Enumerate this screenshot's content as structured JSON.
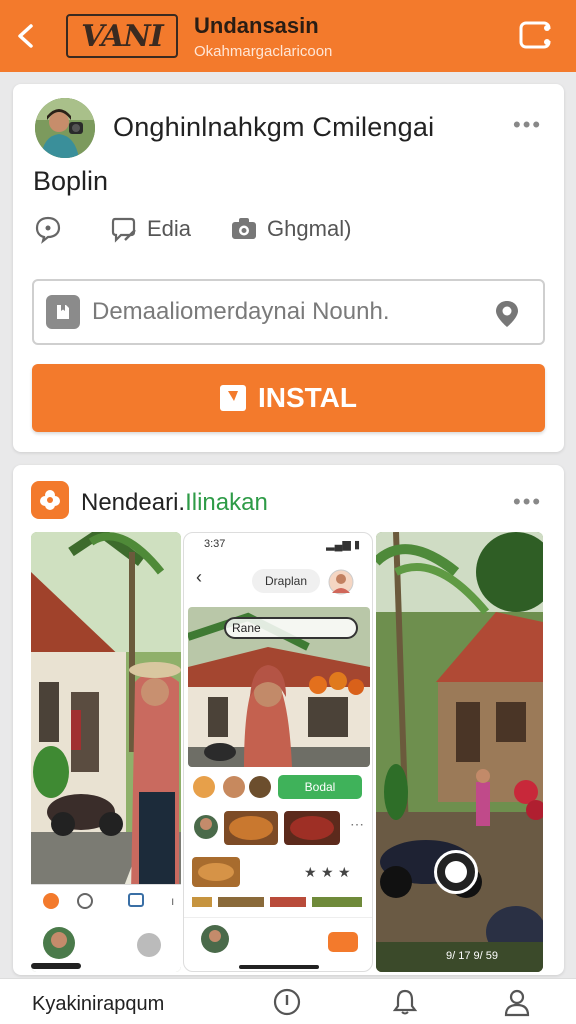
{
  "header": {
    "logo_text": "VANI",
    "title": "Undansasin",
    "subtitle": "Okahmargaclaricoon",
    "back_icon": "arrow-left-icon",
    "menu_icon": "share-menu-icon"
  },
  "post": {
    "title": "Onghinlnahkgm Cmilengai",
    "subtitle": "Boplin",
    "actions": [
      {
        "icon": "chat-bubble-icon",
        "label": ""
      },
      {
        "icon": "chat-edit-icon",
        "label": "Edia"
      },
      {
        "icon": "camera-icon",
        "label": "Ghgmal)"
      }
    ],
    "search_placeholder": "Demaaliomerdaynai Nounh.",
    "install_label": "INSTAL"
  },
  "app_card": {
    "title_main": "Nendeari.",
    "title_accent": "Ilinakan",
    "screenshot_mid": {
      "status_time": "3:37",
      "chip_label": "Draplan",
      "tag_label": "Rane",
      "green_button": "Bodal"
    },
    "screenshot_right_caption": "9/ 17 9/ 59"
  },
  "bottom_bar": {
    "label": "Kyakinirapqum",
    "icons": [
      "info-circle-icon",
      "bell-icon",
      "person-icon"
    ]
  },
  "colors": {
    "accent": "#f37a2c",
    "green": "#3fb25a",
    "background": "#e9e9ea"
  }
}
